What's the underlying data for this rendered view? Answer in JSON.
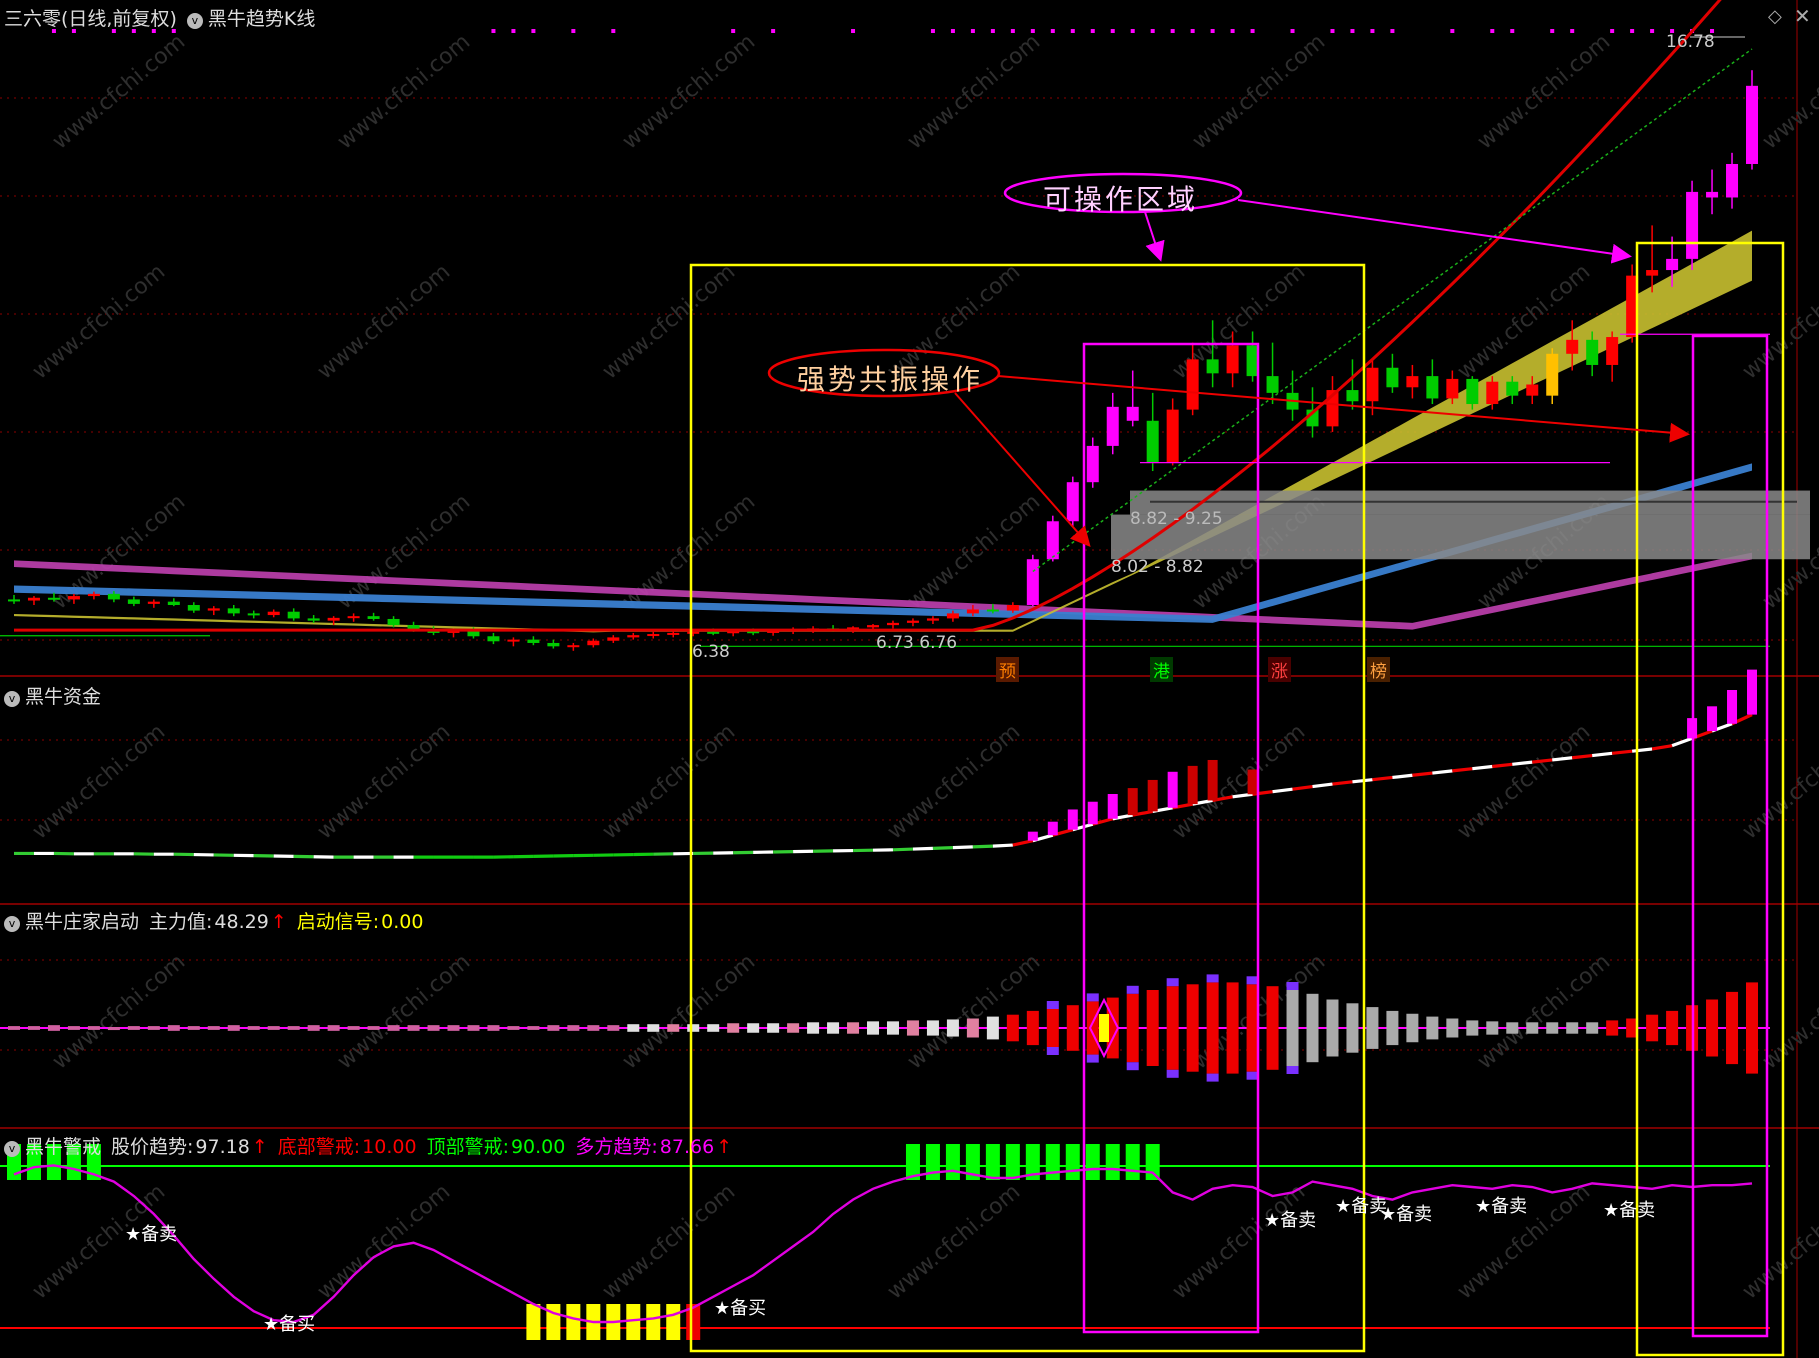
{
  "header": {
    "stock": "三六零(日线,前复权)",
    "indicator": "黑牛趋势K线"
  },
  "panels": {
    "money": {
      "title": "黑牛资金"
    },
    "banker": {
      "title": "黑牛庄家启动",
      "main_label": "主力值:",
      "main_value": "48.29",
      "start_label": "启动信号:",
      "start_value": "0.00"
    },
    "alert": {
      "title": "黑牛警戒",
      "trend_label": "股价趋势:",
      "trend_value": "97.18",
      "bottom_label": "底部警戒:",
      "bottom_value": "10.00",
      "top_label": "顶部警戒:",
      "top_value": "90.00",
      "bull_label": "多方趋势:",
      "bull_value": "87.66"
    }
  },
  "annotations": {
    "operable_zone": "可操作区域",
    "strong_resonance": "强势共振操作",
    "zone1": "8.82 - 9.25",
    "zone2": "8.02 - 8.82",
    "low_price": "6.38",
    "price_range": "6.73  6.76",
    "high_price": "16.78",
    "tag_yu": "预",
    "tag_gang": "港",
    "tag_zhang": "涨",
    "tag_bang": "榜",
    "prepare_buy": "★备买",
    "prepare_sell": "★备卖"
  },
  "colors": {
    "background": "#000000",
    "up": "#ff0000",
    "down": "#00cc00",
    "magenta": "#ff00ff",
    "yellow": "#ffff00",
    "grid": "#8b0000"
  },
  "chart_data": [
    {
      "type": "candlestick",
      "title": "黑牛趋势K线",
      "x": [
        1,
        2,
        3,
        4,
        5,
        6,
        7,
        8,
        9,
        10,
        11,
        12,
        13,
        14,
        15,
        16,
        17,
        18,
        19,
        20,
        21,
        22,
        23,
        24,
        25,
        26,
        27,
        28,
        29,
        30,
        31,
        32,
        33,
        34,
        35,
        36,
        37,
        38,
        39,
        40,
        41,
        42,
        43,
        44,
        45,
        46,
        47,
        48,
        49,
        50,
        51,
        52,
        53,
        54,
        55,
        56,
        57,
        58,
        59,
        60,
        61,
        62,
        63,
        64,
        65,
        66,
        67,
        68,
        69,
        70,
        71,
        72,
        73,
        74,
        75,
        76,
        77,
        78,
        79,
        80,
        81,
        82,
        83,
        84,
        85,
        86,
        87,
        88
      ],
      "ohlc": [
        [
          7.3,
          7.38,
          7.22,
          7.28
        ],
        [
          7.28,
          7.36,
          7.2,
          7.33
        ],
        [
          7.33,
          7.42,
          7.26,
          7.3
        ],
        [
          7.3,
          7.4,
          7.22,
          7.36
        ],
        [
          7.36,
          7.44,
          7.3,
          7.4
        ],
        [
          7.4,
          7.45,
          7.25,
          7.3
        ],
        [
          7.3,
          7.35,
          7.18,
          7.22
        ],
        [
          7.22,
          7.3,
          7.15,
          7.26
        ],
        [
          7.26,
          7.32,
          7.18,
          7.2
        ],
        [
          7.2,
          7.25,
          7.06,
          7.1
        ],
        [
          7.1,
          7.18,
          7.02,
          7.14
        ],
        [
          7.14,
          7.2,
          7.0,
          7.05
        ],
        [
          7.05,
          7.1,
          6.96,
          7.02
        ],
        [
          7.02,
          7.12,
          6.98,
          7.08
        ],
        [
          7.08,
          7.14,
          6.92,
          6.96
        ],
        [
          6.96,
          7.02,
          6.88,
          6.92
        ],
        [
          6.92,
          7.0,
          6.84,
          6.97
        ],
        [
          6.97,
          7.05,
          6.9,
          7.0
        ],
        [
          7.0,
          7.06,
          6.92,
          6.95
        ],
        [
          6.95,
          7.0,
          6.8,
          6.84
        ],
        [
          6.84,
          6.9,
          6.72,
          6.76
        ],
        [
          6.76,
          6.82,
          6.66,
          6.7
        ],
        [
          6.7,
          6.78,
          6.62,
          6.74
        ],
        [
          6.74,
          6.8,
          6.6,
          6.64
        ],
        [
          6.64,
          6.7,
          6.5,
          6.55
        ],
        [
          6.55,
          6.62,
          6.46,
          6.58
        ],
        [
          6.58,
          6.64,
          6.48,
          6.52
        ],
        [
          6.52,
          6.58,
          6.42,
          6.46
        ],
        [
          6.46,
          6.52,
          6.38,
          6.48
        ],
        [
          6.48,
          6.6,
          6.44,
          6.56
        ],
        [
          6.56,
          6.66,
          6.52,
          6.62
        ],
        [
          6.62,
          6.7,
          6.58,
          6.66
        ],
        [
          6.66,
          6.72,
          6.6,
          6.68
        ],
        [
          6.68,
          6.74,
          6.62,
          6.7
        ],
        [
          6.7,
          6.76,
          6.64,
          6.72
        ],
        [
          6.72,
          6.78,
          6.66,
          6.7
        ],
        [
          6.7,
          6.76,
          6.64,
          6.73
        ],
        [
          6.73,
          6.78,
          6.66,
          6.7
        ],
        [
          6.7,
          6.76,
          6.65,
          6.74
        ],
        [
          6.74,
          6.8,
          6.68,
          6.76
        ],
        [
          6.76,
          6.82,
          6.7,
          6.78
        ],
        [
          6.78,
          6.84,
          6.72,
          6.76
        ],
        [
          6.76,
          6.82,
          6.7,
          6.8
        ],
        [
          6.8,
          6.86,
          6.74,
          6.84
        ],
        [
          6.84,
          6.92,
          6.78,
          6.88
        ],
        [
          6.88,
          6.96,
          6.82,
          6.92
        ],
        [
          6.92,
          7.0,
          6.86,
          6.96
        ],
        [
          6.96,
          7.1,
          6.9,
          7.05
        ],
        [
          7.05,
          7.2,
          7.0,
          7.12
        ],
        [
          7.12,
          7.22,
          7.05,
          7.1
        ],
        [
          7.1,
          7.25,
          7.06,
          7.2
        ],
        [
          7.2,
          8.1,
          7.18,
          8.02
        ],
        [
          8.02,
          8.8,
          7.98,
          8.7
        ],
        [
          8.7,
          9.5,
          8.6,
          9.4
        ],
        [
          9.4,
          10.2,
          9.3,
          10.05
        ],
        [
          10.05,
          11.0,
          9.9,
          10.75
        ],
        [
          10.75,
          11.4,
          10.4,
          10.5
        ],
        [
          10.5,
          11.0,
          9.6,
          9.75
        ],
        [
          9.75,
          10.9,
          9.7,
          10.7
        ],
        [
          10.7,
          11.9,
          10.6,
          11.6
        ],
        [
          11.6,
          12.3,
          11.1,
          11.35
        ],
        [
          11.35,
          12.1,
          11.1,
          11.85
        ],
        [
          11.85,
          12.1,
          11.2,
          11.3
        ],
        [
          11.3,
          11.9,
          10.8,
          11.0
        ],
        [
          11.0,
          11.4,
          10.5,
          10.7
        ],
        [
          10.7,
          11.1,
          10.2,
          10.4
        ],
        [
          10.4,
          11.3,
          10.3,
          11.05
        ],
        [
          11.05,
          11.6,
          10.7,
          10.85
        ],
        [
          10.85,
          11.6,
          10.6,
          11.45
        ],
        [
          11.45,
          11.7,
          11.0,
          11.1
        ],
        [
          11.1,
          11.5,
          10.9,
          11.3
        ],
        [
          11.3,
          11.6,
          10.8,
          10.9
        ],
        [
          10.9,
          11.4,
          10.8,
          11.25
        ],
        [
          11.25,
          11.3,
          10.7,
          10.8
        ],
        [
          10.8,
          11.3,
          10.7,
          11.2
        ],
        [
          11.2,
          11.3,
          10.8,
          10.95
        ],
        [
          10.95,
          11.3,
          10.8,
          11.15
        ],
        [
          10.95,
          11.8,
          10.8,
          11.7
        ],
        [
          11.7,
          12.3,
          11.4,
          11.95
        ],
        [
          11.95,
          12.1,
          11.3,
          11.5
        ],
        [
          11.5,
          12.1,
          11.2,
          12.0
        ],
        [
          12.0,
          13.3,
          11.9,
          13.1
        ],
        [
          13.1,
          14.0,
          12.8,
          13.2
        ],
        [
          13.2,
          13.8,
          12.9,
          13.4
        ],
        [
          13.4,
          14.8,
          13.2,
          14.6
        ],
        [
          14.6,
          15.0,
          14.2,
          14.5
        ],
        [
          14.5,
          15.3,
          14.3,
          15.1
        ],
        [
          15.1,
          16.78,
          15.0,
          16.5
        ]
      ],
      "ylim": [
        6.0,
        17.5
      ]
    },
    {
      "type": "bar",
      "title": "黑牛资金",
      "line": [
        1.0,
        1.0,
        1.0,
        0.99,
        0.99,
        0.99,
        0.99,
        0.98,
        0.98,
        0.97,
        0.96,
        0.95,
        0.94,
        0.93,
        0.92,
        0.91,
        0.9,
        0.9,
        0.9,
        0.9,
        0.9,
        0.9,
        0.9,
        0.9,
        0.9,
        0.91,
        0.92,
        0.93,
        0.94,
        0.95,
        0.96,
        0.97,
        0.98,
        0.99,
        1.0,
        1.01,
        1.02,
        1.03,
        1.04,
        1.05,
        1.06,
        1.07,
        1.08,
        1.09,
        1.1,
        1.12,
        1.14,
        1.16,
        1.18,
        1.2,
        1.23,
        1.35,
        1.5,
        1.65,
        1.8,
        1.95,
        2.05,
        2.15,
        2.25,
        2.35,
        2.45,
        2.55,
        2.62,
        2.69,
        2.76,
        2.83,
        2.9,
        2.96,
        3.02,
        3.08,
        3.14,
        3.2,
        3.26,
        3.32,
        3.38,
        3.44,
        3.5,
        3.56,
        3.62,
        3.68,
        3.74,
        3.8,
        3.86,
        3.95,
        4.15,
        4.35,
        4.55,
        4.8
      ],
      "bars": [
        0,
        0,
        0,
        0,
        0,
        0,
        0,
        0,
        0,
        0,
        0,
        0,
        0,
        0,
        0,
        0,
        0,
        0,
        0,
        0,
        0,
        0,
        0,
        0,
        0,
        0,
        0,
        0,
        0,
        0,
        0,
        0,
        0,
        0,
        0,
        0,
        0,
        0,
        0,
        0,
        0,
        0,
        0,
        0,
        0,
        0,
        0,
        0,
        0,
        0,
        0,
        0.2,
        0.3,
        0.45,
        0.5,
        0.55,
        0.6,
        0.7,
        0.8,
        0.85,
        0.9,
        0,
        0.55,
        0,
        0,
        0,
        0,
        0,
        0,
        0,
        0,
        0,
        0,
        0,
        0,
        0,
        0,
        0,
        0,
        0,
        0,
        0,
        0,
        0,
        0.45,
        0.55,
        0.75,
        1.0
      ]
    },
    {
      "type": "bar",
      "title": "黑牛庄家启动",
      "series": [
        {
          "name": "主力值",
          "values": [
            2,
            2,
            3,
            2,
            2,
            1,
            2,
            2,
            3,
            2,
            2,
            3,
            2,
            2,
            2,
            3,
            3,
            2,
            2,
            3,
            3,
            3,
            3,
            3,
            3,
            2,
            2,
            3,
            3,
            3,
            3,
            4,
            4,
            4,
            4,
            4,
            5,
            5,
            5,
            5,
            6,
            6,
            6,
            7,
            7,
            8,
            8,
            9,
            10,
            12,
            14,
            18,
            20,
            24,
            28,
            32,
            36,
            40,
            44,
            46,
            48,
            48,
            46,
            44,
            40,
            36,
            30,
            26,
            22,
            18,
            15,
            12,
            10,
            8,
            7,
            6,
            6,
            6,
            6,
            6,
            8,
            10,
            14,
            18,
            24,
            30,
            38,
            48
          ]
        }
      ]
    },
    {
      "type": "line",
      "title": "黑牛警戒",
      "series": [
        {
          "name": "股价趋势",
          "values": [
            92,
            96,
            97,
            95,
            92,
            88,
            80,
            70,
            58,
            45,
            34,
            24,
            16,
            11,
            10,
            14,
            24,
            36,
            46,
            52,
            54,
            50,
            44,
            38,
            32,
            26,
            20,
            15,
            12,
            10,
            10,
            11,
            12,
            14,
            18,
            24,
            30,
            36,
            44,
            52,
            60,
            70,
            78,
            84,
            88,
            91,
            93,
            94,
            92,
            90,
            90,
            92,
            93,
            94,
            95,
            95,
            94,
            93,
            82,
            78,
            84,
            86,
            85,
            80,
            82,
            88,
            86,
            84,
            80,
            78,
            82,
            84,
            86,
            85,
            84,
            86,
            85,
            82,
            84,
            87,
            86,
            85,
            84,
            86,
            85,
            86,
            86,
            87
          ]
        }
      ],
      "bottom_alert": 10.0,
      "top_alert": 90.0,
      "ylim": [
        0,
        100
      ]
    }
  ]
}
